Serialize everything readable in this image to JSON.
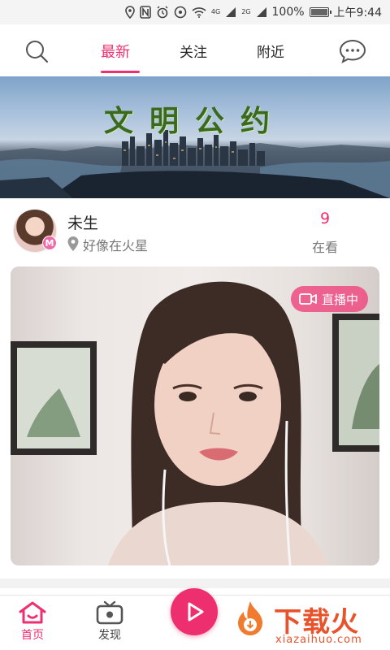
{
  "status_bar": {
    "network_1": "4G",
    "network_2": "2G",
    "battery": "100%",
    "time": "上午9:44",
    "icons": [
      "location-icon",
      "nfc-icon",
      "alarm-icon",
      "eye-comfort-icon",
      "wifi-icon",
      "signal-icon",
      "signal-icon",
      "battery-icon"
    ]
  },
  "top_nav": {
    "tabs": [
      {
        "label": "最新",
        "active": true
      },
      {
        "label": "关注",
        "active": false
      },
      {
        "label": "附近",
        "active": false
      }
    ],
    "search_icon": "search-icon",
    "message_icon": "chat-bubble-icon",
    "accent_color": "#ee2f6f"
  },
  "banner": {
    "title": "文明公约"
  },
  "streamer": {
    "name": "未生",
    "location": "好像在火星",
    "viewer_count": "9",
    "viewer_label": "在看",
    "badge": "M"
  },
  "video": {
    "live_label": "直播中",
    "live_icon": "video-camera-icon"
  },
  "bottom_bar": {
    "items": [
      {
        "label": "首页",
        "icon": "home-icon",
        "active": true
      },
      {
        "label": "发现",
        "icon": "tv-icon",
        "active": false
      }
    ],
    "play_icon": "play-icon"
  },
  "watermark": {
    "title": "下载火",
    "subtitle": "xiazaihuo.com"
  }
}
